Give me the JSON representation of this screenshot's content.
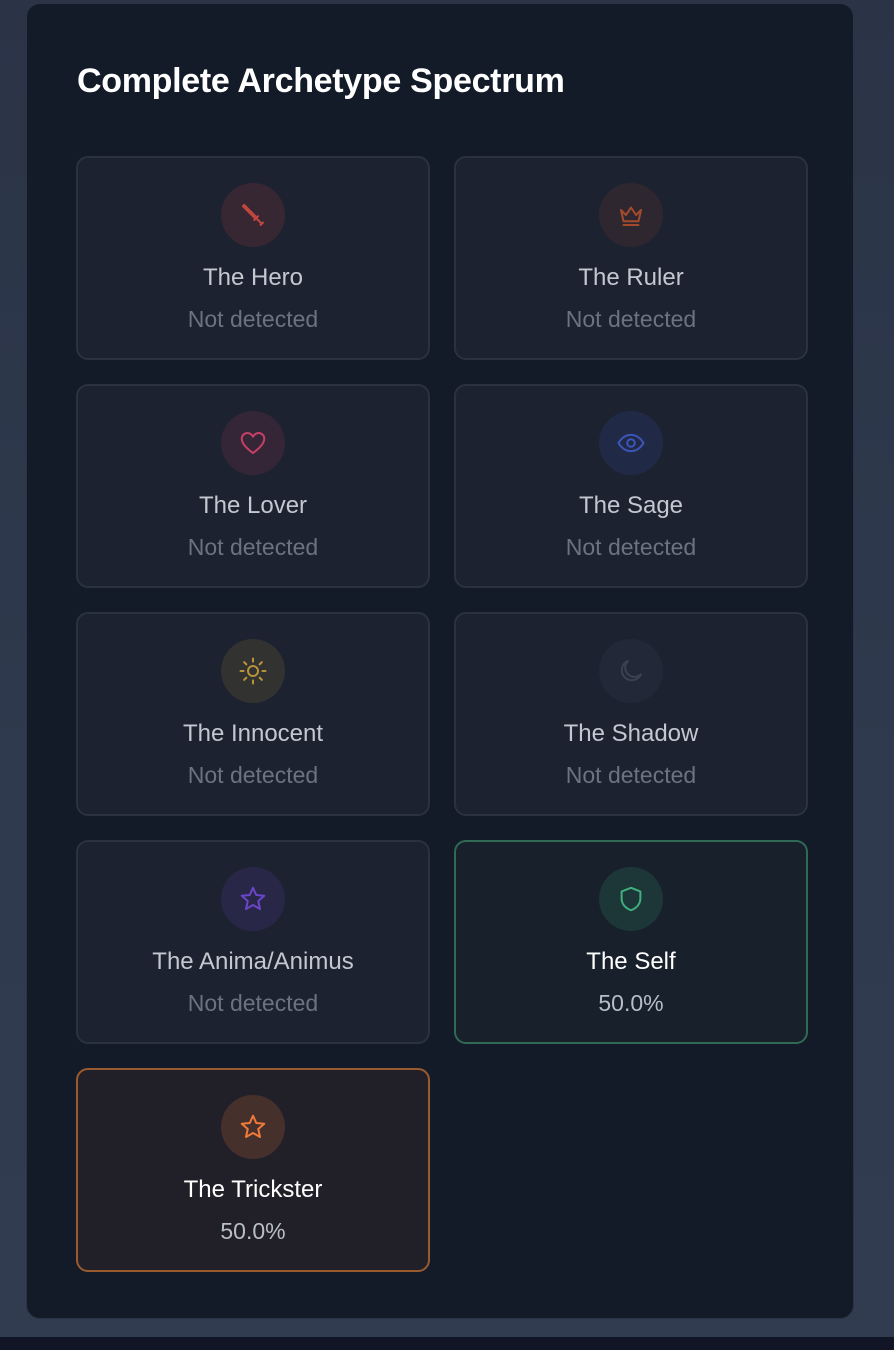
{
  "panel": {
    "title": "Complete Archetype Spectrum"
  },
  "archetypes": [
    {
      "name": "The Hero",
      "status": "Not detected",
      "icon": "sword-icon",
      "color": "#c0473f",
      "active": false
    },
    {
      "name": "The Ruler",
      "status": "Not detected",
      "icon": "crown-icon",
      "color": "#a34a2c",
      "active": false
    },
    {
      "name": "The Lover",
      "status": "Not detected",
      "icon": "heart-icon",
      "color": "#c63f66",
      "active": false
    },
    {
      "name": "The Sage",
      "status": "Not detected",
      "icon": "eye-icon",
      "color": "#3b55b8",
      "active": false
    },
    {
      "name": "The Innocent",
      "status": "Not detected",
      "icon": "sun-icon",
      "color": "#b8933a",
      "active": false
    },
    {
      "name": "The Shadow",
      "status": "Not detected",
      "icon": "moon-icon",
      "color": "#3a4150",
      "active": false
    },
    {
      "name": "The Anima/Animus",
      "status": "Not detected",
      "icon": "star-icon",
      "color": "#6a46c8",
      "active": false
    },
    {
      "name": "The Self",
      "status": "50.0%",
      "icon": "shield-icon",
      "color": "#3fb07e",
      "active": true
    },
    {
      "name": "The Trickster",
      "status": "50.0%",
      "icon": "star-icon",
      "color": "#f07a3a",
      "active": true
    }
  ]
}
